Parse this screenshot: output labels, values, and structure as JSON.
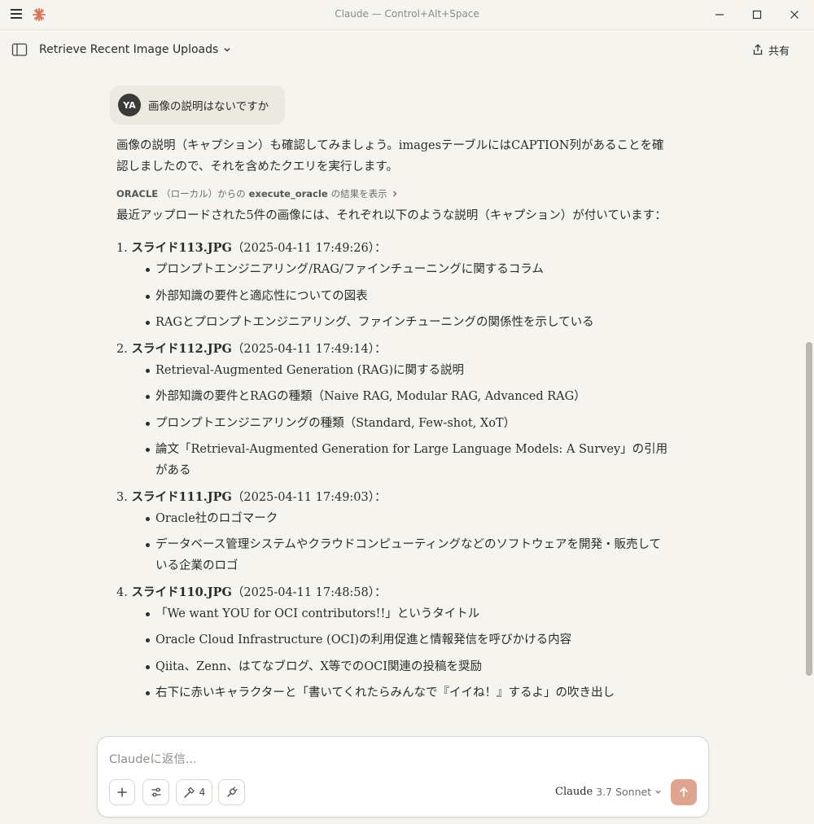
{
  "window": {
    "title": "Claude — Control+Alt+Space"
  },
  "header": {
    "conversation_title": "Retrieve Recent Image Uploads",
    "share_label": "共有"
  },
  "user_message": {
    "avatar_initials": "YA",
    "text": "画像の説明はないですか"
  },
  "assistant": {
    "intro": "画像の説明（キャプション）も確認してみましょう。imagesテーブルにはCAPTION列があることを確認しましたので、それを含めたクエリを実行します。",
    "tool_result": {
      "source": "ORACLE",
      "source_suffix": "（ローカル）からの",
      "tool": "execute_oracle",
      "action": "の結果を表示"
    },
    "summary": "最近アップロードされた5件の画像には、それぞれ以下のような説明（キャプション）が付いています：",
    "items": [
      {
        "number": "1.",
        "name": "スライド113.JPG",
        "timestamp": "（2025-04-11 17:49:26）：",
        "bullets": [
          "プロンプトエンジニアリング/RAG/ファインチューニングに関するコラム",
          "外部知識の要件と適応性についての図表",
          "RAGとプロンプトエンジニアリング、ファインチューニングの関係性を示している"
        ]
      },
      {
        "number": "2.",
        "name": "スライド112.JPG",
        "timestamp": "（2025-04-11 17:49:14）：",
        "bullets": [
          "Retrieval-Augmented Generation (RAG)に関する説明",
          "外部知識の要件とRAGの種類（Naive RAG, Modular RAG, Advanced RAG）",
          "プロンプトエンジニアリングの種類（Standard, Few-shot, XoT）",
          "論文「Retrieval-Augmented Generation for Large Language Models: A Survey」の引用がある"
        ]
      },
      {
        "number": "3.",
        "name": "スライド111.JPG",
        "timestamp": "（2025-04-11 17:49:03）：",
        "bullets": [
          "Oracle社のロゴマーク",
          "データベース管理システムやクラウドコンピューティングなどのソフトウェアを開発・販売している企業のロゴ"
        ]
      },
      {
        "number": "4.",
        "name": "スライド110.JPG",
        "timestamp": "（2025-04-11 17:48:58）：",
        "bullets": [
          "「We want YOU for OCI contributors!!」というタイトル",
          "Oracle Cloud Infrastructure (OCI)の利用促進と情報発信を呼びかける内容",
          "Qiita、Zenn、はてなブログ、X等でのOCI関連の投稿を奨励",
          "右下に赤いキャラクターと「書いてくれたらみんなで『イイね！』するよ」の吹き出し"
        ]
      }
    ]
  },
  "composer": {
    "placeholder": "Claudeに返信...",
    "tools_count": "4",
    "model_name": "Claude",
    "model_version": "3.7 Sonnet"
  },
  "colors": {
    "background": "#f5f4ef",
    "accent": "#d97757",
    "send_button": "#dea48d",
    "user_bubble": "#ebe9e0"
  }
}
